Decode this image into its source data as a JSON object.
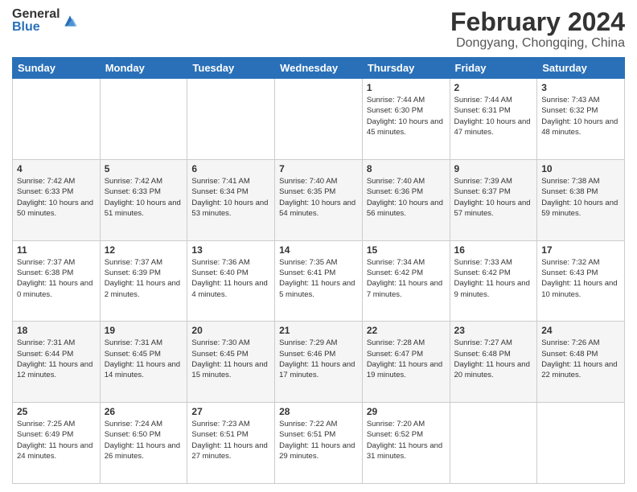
{
  "logo": {
    "general": "General",
    "blue": "Blue"
  },
  "header": {
    "month": "February 2024",
    "location": "Dongyang, Chongqing, China"
  },
  "weekdays": [
    "Sunday",
    "Monday",
    "Tuesday",
    "Wednesday",
    "Thursday",
    "Friday",
    "Saturday"
  ],
  "weeks": [
    [
      {
        "day": "",
        "sunrise": "",
        "sunset": "",
        "daylight": ""
      },
      {
        "day": "",
        "sunrise": "",
        "sunset": "",
        "daylight": ""
      },
      {
        "day": "",
        "sunrise": "",
        "sunset": "",
        "daylight": ""
      },
      {
        "day": "",
        "sunrise": "",
        "sunset": "",
        "daylight": ""
      },
      {
        "day": "1",
        "sunrise": "Sunrise: 7:44 AM",
        "sunset": "Sunset: 6:30 PM",
        "daylight": "Daylight: 10 hours and 45 minutes."
      },
      {
        "day": "2",
        "sunrise": "Sunrise: 7:44 AM",
        "sunset": "Sunset: 6:31 PM",
        "daylight": "Daylight: 10 hours and 47 minutes."
      },
      {
        "day": "3",
        "sunrise": "Sunrise: 7:43 AM",
        "sunset": "Sunset: 6:32 PM",
        "daylight": "Daylight: 10 hours and 48 minutes."
      }
    ],
    [
      {
        "day": "4",
        "sunrise": "Sunrise: 7:42 AM",
        "sunset": "Sunset: 6:33 PM",
        "daylight": "Daylight: 10 hours and 50 minutes."
      },
      {
        "day": "5",
        "sunrise": "Sunrise: 7:42 AM",
        "sunset": "Sunset: 6:33 PM",
        "daylight": "Daylight: 10 hours and 51 minutes."
      },
      {
        "day": "6",
        "sunrise": "Sunrise: 7:41 AM",
        "sunset": "Sunset: 6:34 PM",
        "daylight": "Daylight: 10 hours and 53 minutes."
      },
      {
        "day": "7",
        "sunrise": "Sunrise: 7:40 AM",
        "sunset": "Sunset: 6:35 PM",
        "daylight": "Daylight: 10 hours and 54 minutes."
      },
      {
        "day": "8",
        "sunrise": "Sunrise: 7:40 AM",
        "sunset": "Sunset: 6:36 PM",
        "daylight": "Daylight: 10 hours and 56 minutes."
      },
      {
        "day": "9",
        "sunrise": "Sunrise: 7:39 AM",
        "sunset": "Sunset: 6:37 PM",
        "daylight": "Daylight: 10 hours and 57 minutes."
      },
      {
        "day": "10",
        "sunrise": "Sunrise: 7:38 AM",
        "sunset": "Sunset: 6:38 PM",
        "daylight": "Daylight: 10 hours and 59 minutes."
      }
    ],
    [
      {
        "day": "11",
        "sunrise": "Sunrise: 7:37 AM",
        "sunset": "Sunset: 6:38 PM",
        "daylight": "Daylight: 11 hours and 0 minutes."
      },
      {
        "day": "12",
        "sunrise": "Sunrise: 7:37 AM",
        "sunset": "Sunset: 6:39 PM",
        "daylight": "Daylight: 11 hours and 2 minutes."
      },
      {
        "day": "13",
        "sunrise": "Sunrise: 7:36 AM",
        "sunset": "Sunset: 6:40 PM",
        "daylight": "Daylight: 11 hours and 4 minutes."
      },
      {
        "day": "14",
        "sunrise": "Sunrise: 7:35 AM",
        "sunset": "Sunset: 6:41 PM",
        "daylight": "Daylight: 11 hours and 5 minutes."
      },
      {
        "day": "15",
        "sunrise": "Sunrise: 7:34 AM",
        "sunset": "Sunset: 6:42 PM",
        "daylight": "Daylight: 11 hours and 7 minutes."
      },
      {
        "day": "16",
        "sunrise": "Sunrise: 7:33 AM",
        "sunset": "Sunset: 6:42 PM",
        "daylight": "Daylight: 11 hours and 9 minutes."
      },
      {
        "day": "17",
        "sunrise": "Sunrise: 7:32 AM",
        "sunset": "Sunset: 6:43 PM",
        "daylight": "Daylight: 11 hours and 10 minutes."
      }
    ],
    [
      {
        "day": "18",
        "sunrise": "Sunrise: 7:31 AM",
        "sunset": "Sunset: 6:44 PM",
        "daylight": "Daylight: 11 hours and 12 minutes."
      },
      {
        "day": "19",
        "sunrise": "Sunrise: 7:31 AM",
        "sunset": "Sunset: 6:45 PM",
        "daylight": "Daylight: 11 hours and 14 minutes."
      },
      {
        "day": "20",
        "sunrise": "Sunrise: 7:30 AM",
        "sunset": "Sunset: 6:45 PM",
        "daylight": "Daylight: 11 hours and 15 minutes."
      },
      {
        "day": "21",
        "sunrise": "Sunrise: 7:29 AM",
        "sunset": "Sunset: 6:46 PM",
        "daylight": "Daylight: 11 hours and 17 minutes."
      },
      {
        "day": "22",
        "sunrise": "Sunrise: 7:28 AM",
        "sunset": "Sunset: 6:47 PM",
        "daylight": "Daylight: 11 hours and 19 minutes."
      },
      {
        "day": "23",
        "sunrise": "Sunrise: 7:27 AM",
        "sunset": "Sunset: 6:48 PM",
        "daylight": "Daylight: 11 hours and 20 minutes."
      },
      {
        "day": "24",
        "sunrise": "Sunrise: 7:26 AM",
        "sunset": "Sunset: 6:48 PM",
        "daylight": "Daylight: 11 hours and 22 minutes."
      }
    ],
    [
      {
        "day": "25",
        "sunrise": "Sunrise: 7:25 AM",
        "sunset": "Sunset: 6:49 PM",
        "daylight": "Daylight: 11 hours and 24 minutes."
      },
      {
        "day": "26",
        "sunrise": "Sunrise: 7:24 AM",
        "sunset": "Sunset: 6:50 PM",
        "daylight": "Daylight: 11 hours and 26 minutes."
      },
      {
        "day": "27",
        "sunrise": "Sunrise: 7:23 AM",
        "sunset": "Sunset: 6:51 PM",
        "daylight": "Daylight: 11 hours and 27 minutes."
      },
      {
        "day": "28",
        "sunrise": "Sunrise: 7:22 AM",
        "sunset": "Sunset: 6:51 PM",
        "daylight": "Daylight: 11 hours and 29 minutes."
      },
      {
        "day": "29",
        "sunrise": "Sunrise: 7:20 AM",
        "sunset": "Sunset: 6:52 PM",
        "daylight": "Daylight: 11 hours and 31 minutes."
      },
      {
        "day": "",
        "sunrise": "",
        "sunset": "",
        "daylight": ""
      },
      {
        "day": "",
        "sunrise": "",
        "sunset": "",
        "daylight": ""
      }
    ]
  ]
}
